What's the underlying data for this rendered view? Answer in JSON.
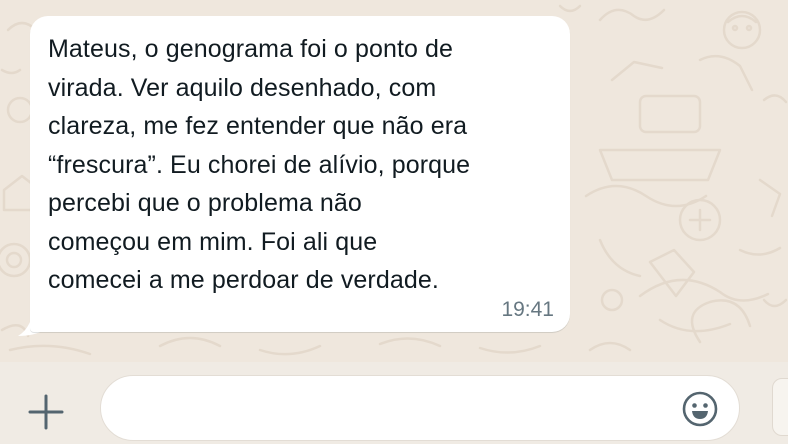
{
  "conversation": {
    "messages": [
      {
        "direction": "incoming",
        "text": "Mateus, o genograma foi o ponto de\nvirada. Ver aquilo desenhado, com\nclareza, me fez entender que não era\n“frescura”. Eu chorei de alívio, porque\npercebi que o problema não\ncomeçou em mim. Foi ali que\ncomecei a me perdoar de verdade.",
        "time": "19:41"
      }
    ]
  },
  "composer": {
    "attach_icon": "plus-icon",
    "input_value": "",
    "emoji_icon": "smiley-icon"
  },
  "colors": {
    "wallpaper": "#efe7dd",
    "bubble": "#ffffff",
    "text": "#111b21",
    "timestamp": "#667781",
    "icon": "#54656f"
  }
}
